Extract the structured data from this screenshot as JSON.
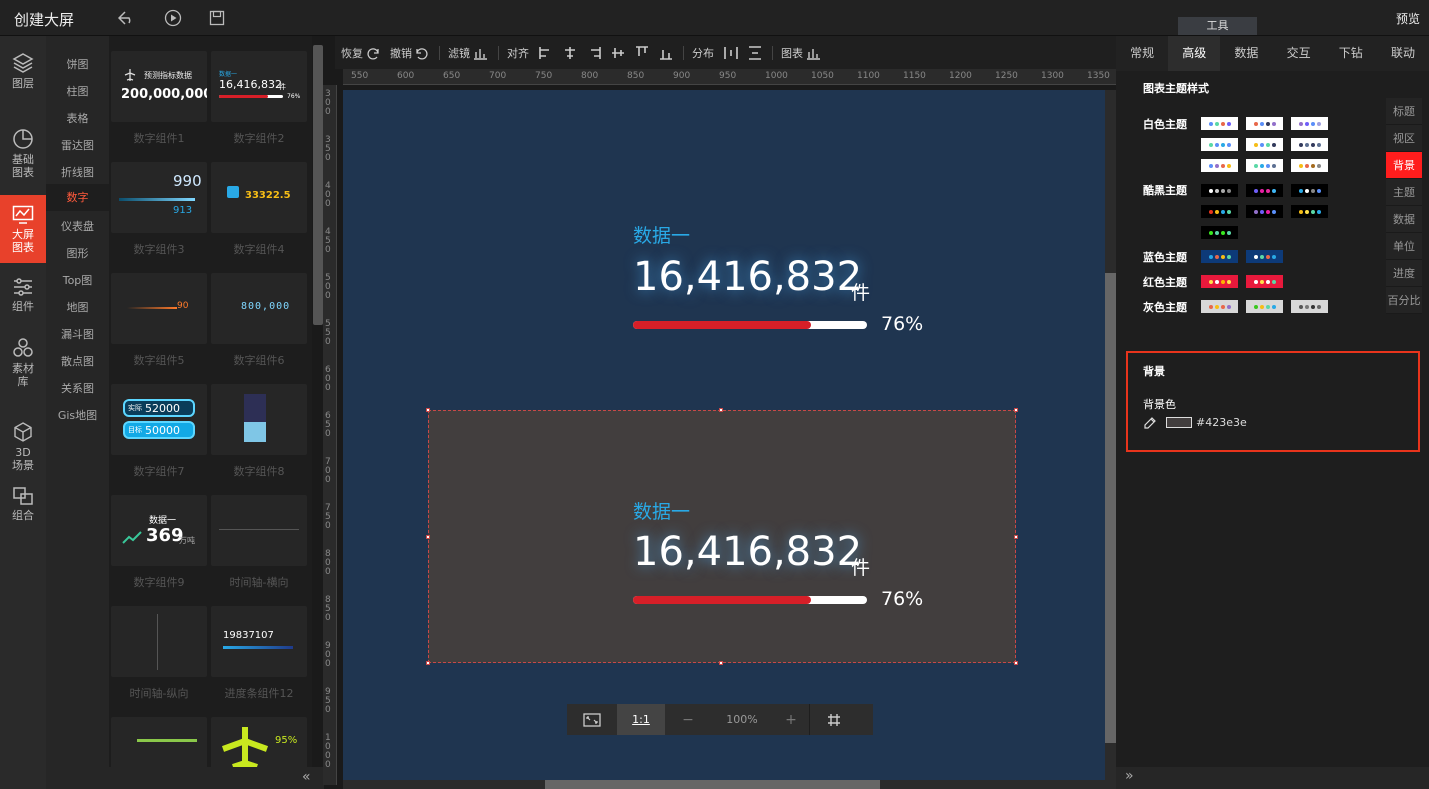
{
  "app": {
    "title": "创建大屏",
    "tools_tab": "工具",
    "preview": "预览"
  },
  "left_nav": [
    {
      "label": "图层",
      "icon": "layers-icon"
    },
    {
      "label": "基础图表",
      "icon": "pie-chart-icon"
    },
    {
      "label": "大屏图表",
      "icon": "big-screen-chart-icon"
    },
    {
      "label": "组件",
      "icon": "sliders-icon"
    },
    {
      "label": "素材库",
      "icon": "hexagons-icon"
    },
    {
      "label": "3D场景",
      "icon": "cube-icon"
    },
    {
      "label": "组合",
      "icon": "group-icon"
    }
  ],
  "categories": [
    "饼图",
    "柱图",
    "表格",
    "雷达图",
    "折线图",
    "数字",
    "仪表盘",
    "图形",
    "Top图",
    "地图",
    "漏斗图",
    "散点图",
    "关系图",
    "Gis地图"
  ],
  "components": [
    {
      "label": "数字组件1",
      "thumb_text": "预测指标数据",
      "thumb_value": "200,000,000"
    },
    {
      "label": "数字组件2",
      "thumb_text": "数据一",
      "thumb_value": "16,416,832",
      "thumb_unit": "件",
      "thumb_pct": "76%"
    },
    {
      "label": "数字组件3",
      "thumb_value": "990",
      "thumb_value2": "913"
    },
    {
      "label": "数字组件4",
      "thumb_value": "33322.5"
    },
    {
      "label": "数字组件5",
      "thumb_value": "90"
    },
    {
      "label": "数字组件6",
      "thumb_value": "800,000"
    },
    {
      "label": "数字组件7",
      "thumb_a_label": "实际",
      "thumb_a": "52000",
      "thumb_b_label": "目标",
      "thumb_b": "50000"
    },
    {
      "label": "数字组件8"
    },
    {
      "label": "数字组件9",
      "thumb_text": "数据一",
      "thumb_value": "369",
      "thumb_unit": "万吨"
    },
    {
      "label": "时间轴-横向"
    },
    {
      "label": "时间轴-纵向"
    },
    {
      "label": "进度条组件12",
      "thumb_value": "19837107"
    },
    {
      "label": ""
    },
    {
      "label": "",
      "thumb_pct": "95%"
    }
  ],
  "toolbar": {
    "redo": "恢复",
    "undo": "撤销",
    "filter": "滤镜",
    "align": "对齐",
    "distribute": "分布",
    "chart": "图表"
  },
  "ruler_top": [
    "550",
    "600",
    "650",
    "700",
    "750",
    "800",
    "850",
    "900",
    "950",
    "1000",
    "1050",
    "1100",
    "1150",
    "1200",
    "1250",
    "1300",
    "1350"
  ],
  "ruler_left": [
    "300",
    "350",
    "400",
    "450",
    "500",
    "550",
    "600",
    "650",
    "700",
    "750",
    "800",
    "850",
    "900",
    "950",
    "1000"
  ],
  "widgets": [
    {
      "title": "数据一",
      "value": "16,416,832",
      "unit": "件",
      "percent": "76%",
      "progress": 0.76
    },
    {
      "title": "数据一",
      "value": "16,416,832",
      "unit": "件",
      "percent": "76%",
      "progress": 0.76
    }
  ],
  "zoom": {
    "fit_icon": "fit-screen-icon",
    "ratio": "1:1",
    "minus": "−",
    "level": "100%",
    "plus": "+",
    "grid_icon": "grid-icon"
  },
  "right_tabs": [
    "常规",
    "高级",
    "数据",
    "交互",
    "下钻",
    "联动"
  ],
  "active_right_tab": "高级",
  "theme": {
    "heading": "图表主题样式",
    "groups": [
      {
        "label": "白色主题",
        "bg": "#ffffff",
        "swatches": [
          [
            "#5b8ff9",
            "#5ad8a6",
            "#e8684a",
            "#6f5ef9"
          ],
          [
            "#e8684a",
            "#5b8ff9",
            "#333a5c",
            "#9270ca"
          ],
          [
            "#9270ca",
            "#6f5ef9",
            "#5b8ff9",
            "#a0a0e0"
          ],
          [
            "#5ad8a6",
            "#5b8ff9",
            "#29a9e6",
            "#5b8ff9"
          ],
          [
            "#f6bd16",
            "#5b8ff9",
            "#5ad8a6",
            "#333a5c"
          ],
          [
            "#333a5c",
            "#5d7092",
            "#333a5c",
            "#5d7092"
          ],
          [
            "#5b8ff9",
            "#9270ca",
            "#e8684a",
            "#f6bd16"
          ],
          [
            "#5ad8a6",
            "#29a9e6",
            "#5b8ff9",
            "#5d7092"
          ],
          [
            "#f6bd16",
            "#e8684a",
            "#a46b1f",
            "#888"
          ]
        ]
      },
      {
        "label": "酷黑主题",
        "bg": "#000000",
        "swatches": [
          [
            "#ffffff",
            "#cccccc",
            "#aaaaaa",
            "#888888"
          ],
          [
            "#6f5ef9",
            "#e81fa5",
            "#e82aa0",
            "#3fb7f4"
          ],
          [
            "#29a9e6",
            "#ffffff",
            "#888888",
            "#5b8ff9"
          ],
          [
            "#e8341c",
            "#f6bd16",
            "#29a9e6",
            "#5ad8a6"
          ],
          [
            "#9270ca",
            "#6f5ef9",
            "#e81fa5",
            "#5b8ff9"
          ],
          [
            "#f6bd16",
            "#ffe14a",
            "#5ad8a6",
            "#29a9e6"
          ],
          [
            "#39e81f",
            "#5ad8a6",
            "#39e81f",
            "#5ad8a6"
          ]
        ]
      },
      {
        "label": "蓝色主题",
        "bg": "#0d3a78",
        "swatches": [
          [
            "#29a9e6",
            "#e8684a",
            "#f6bd16",
            "#5ad8a6"
          ],
          [
            "#ffffff",
            "#5ad8a6",
            "#e8684a",
            "#29a9e6"
          ]
        ]
      },
      {
        "label": "红色主题",
        "bg": "#e8193c",
        "swatches": [
          [
            "#ffe14a",
            "#ffffff",
            "#ffb300",
            "#ffe14a"
          ],
          [
            "#ffffff",
            "#ffe14a",
            "#ffffff",
            "#5ad8a6"
          ]
        ]
      },
      {
        "label": "灰色主题",
        "bg": "#d8d8d8",
        "swatches": [
          [
            "#e8684a",
            "#f6bd16",
            "#e8684a",
            "#9270ca"
          ],
          [
            "#39c81f",
            "#f6bd16",
            "#5ad8a6",
            "#29a9e6"
          ],
          [
            "#555555",
            "#777777",
            "#333333",
            "#666666"
          ]
        ]
      }
    ]
  },
  "side_tabs": [
    "标题",
    "视区",
    "背景",
    "主题",
    "数据",
    "单位",
    "进度",
    "百分比"
  ],
  "active_side_tab": "背景",
  "background": {
    "title": "背景",
    "color_label": "背景色",
    "color_value": "#423e3e"
  }
}
